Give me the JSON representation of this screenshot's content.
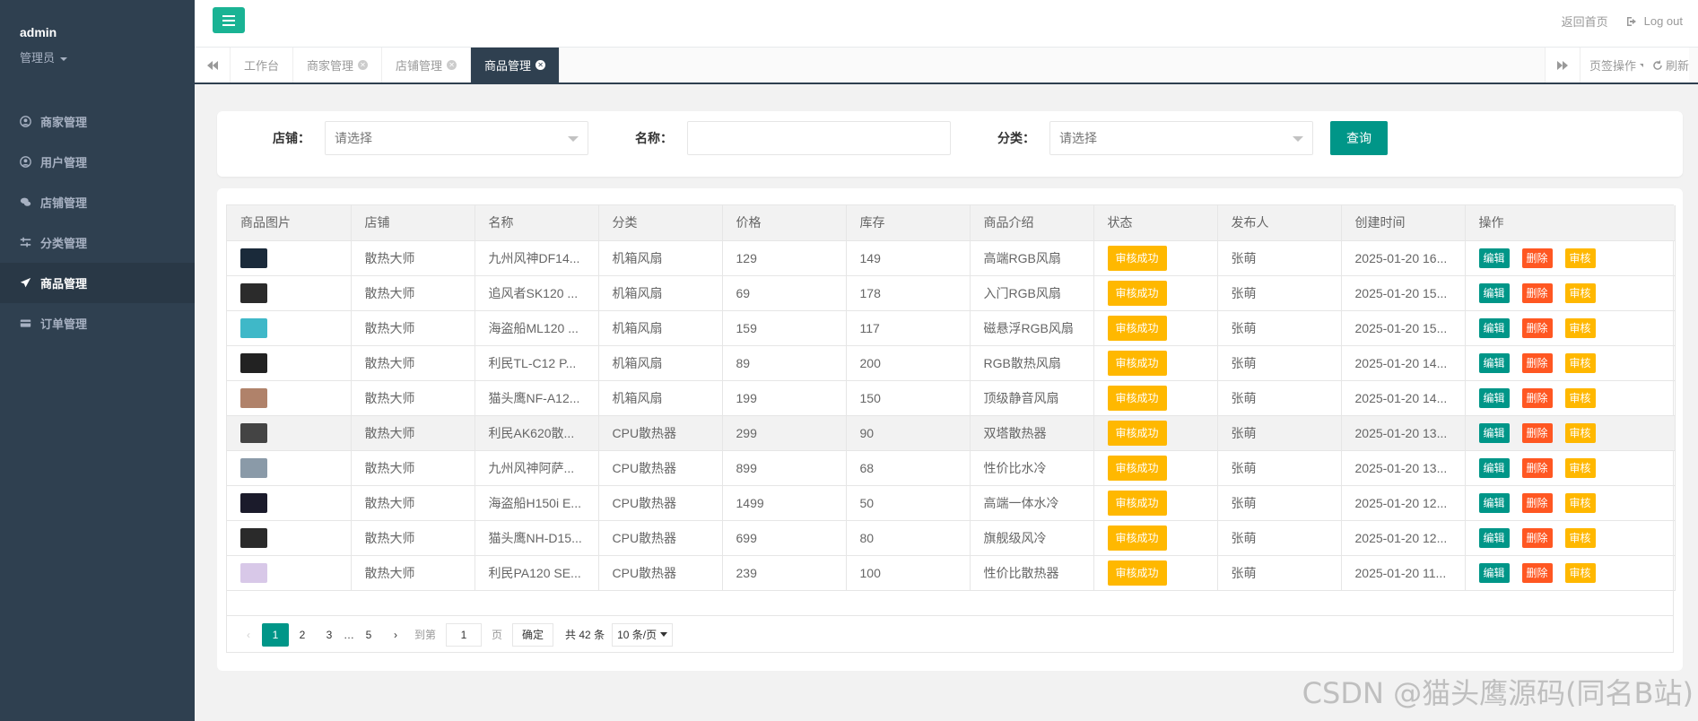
{
  "sidebar": {
    "user": "admin",
    "role": "管理员",
    "items": [
      {
        "label": "商家管理",
        "icon": "user-circle-icon",
        "active": false
      },
      {
        "label": "用户管理",
        "icon": "user-circle-icon",
        "active": false
      },
      {
        "label": "店铺管理",
        "icon": "comments-icon",
        "active": false
      },
      {
        "label": "分类管理",
        "icon": "sliders-icon",
        "active": false
      },
      {
        "label": "商品管理",
        "icon": "paper-plane-icon",
        "active": true
      },
      {
        "label": "订单管理",
        "icon": "credit-card-icon",
        "active": false
      }
    ]
  },
  "header": {
    "home_label": "返回首页",
    "logout_label": "Log out"
  },
  "tabs": {
    "items": [
      {
        "label": "工作台",
        "closable": false,
        "active": false
      },
      {
        "label": "商家管理",
        "closable": true,
        "active": false
      },
      {
        "label": "店铺管理",
        "closable": true,
        "active": false
      },
      {
        "label": "商品管理",
        "closable": true,
        "active": true
      }
    ],
    "ops_label": "页签操作",
    "refresh_label": "刷新"
  },
  "search": {
    "store_label": "店铺：",
    "store_placeholder": "请选择",
    "name_label": "名称：",
    "name_value": "",
    "category_label": "分类：",
    "category_placeholder": "请选择",
    "query_button": "查询"
  },
  "table": {
    "columns": [
      "商品图片",
      "店铺",
      "名称",
      "分类",
      "价格",
      "库存",
      "商品介绍",
      "状态",
      "发布人",
      "创建时间",
      "操作"
    ],
    "rows": [
      {
        "store": "散热大师",
        "name": "九州风神DF14...",
        "category": "机箱风扇",
        "price": "129",
        "stock": "149",
        "intro": "高端RGB风扇",
        "status": "审核成功",
        "publisher": "张萌",
        "created": "2025-01-20 16...",
        "thumb": "#1a2a3a"
      },
      {
        "store": "散热大师",
        "name": "追风者SK120 ...",
        "category": "机箱风扇",
        "price": "69",
        "stock": "178",
        "intro": "入门RGB风扇",
        "status": "审核成功",
        "publisher": "张萌",
        "created": "2025-01-20 15...",
        "thumb": "#2b2b2b"
      },
      {
        "store": "散热大师",
        "name": "海盗船ML120 ...",
        "category": "机箱风扇",
        "price": "159",
        "stock": "117",
        "intro": "磁悬浮RGB风扇",
        "status": "审核成功",
        "publisher": "张萌",
        "created": "2025-01-20 15...",
        "thumb": "#3fb8c8"
      },
      {
        "store": "散热大师",
        "name": "利民TL-C12 P...",
        "category": "机箱风扇",
        "price": "89",
        "stock": "200",
        "intro": "RGB散热风扇",
        "status": "审核成功",
        "publisher": "张萌",
        "created": "2025-01-20 14...",
        "thumb": "#222222"
      },
      {
        "store": "散热大师",
        "name": "猫头鹰NF-A12...",
        "category": "机箱风扇",
        "price": "199",
        "stock": "150",
        "intro": "顶级静音风扇",
        "status": "审核成功",
        "publisher": "张萌",
        "created": "2025-01-20 14...",
        "thumb": "#b0826a"
      },
      {
        "store": "散热大师",
        "name": "利民AK620散...",
        "category": "CPU散热器",
        "price": "299",
        "stock": "90",
        "intro": "双塔散热器",
        "status": "审核成功",
        "publisher": "张萌",
        "created": "2025-01-20 13...",
        "thumb": "#444444"
      },
      {
        "store": "散热大师",
        "name": "九州风神阿萨...",
        "category": "CPU散热器",
        "price": "899",
        "stock": "68",
        "intro": "性价比水冷",
        "status": "审核成功",
        "publisher": "张萌",
        "created": "2025-01-20 13...",
        "thumb": "#8a9aa8"
      },
      {
        "store": "散热大师",
        "name": "海盗船H150i E...",
        "category": "CPU散热器",
        "price": "1499",
        "stock": "50",
        "intro": "高端一体水冷",
        "status": "审核成功",
        "publisher": "张萌",
        "created": "2025-01-20 12...",
        "thumb": "#1b1b2b"
      },
      {
        "store": "散热大师",
        "name": "猫头鹰NH-D15...",
        "category": "CPU散热器",
        "price": "699",
        "stock": "80",
        "intro": "旗舰级风冷",
        "status": "审核成功",
        "publisher": "张萌",
        "created": "2025-01-20 12...",
        "thumb": "#2a2a2a"
      },
      {
        "store": "散热大师",
        "name": "利民PA120 SE...",
        "category": "CPU散热器",
        "price": "239",
        "stock": "100",
        "intro": "性价比散热器",
        "status": "审核成功",
        "publisher": "张萌",
        "created": "2025-01-20 11...",
        "thumb": "#d8c8e8"
      }
    ],
    "actions": {
      "edit": "编辑",
      "delete": "删除",
      "audit": "审核"
    }
  },
  "pager": {
    "pages": [
      "1",
      "2",
      "3",
      "…",
      "5"
    ],
    "current": "1",
    "goto_label": "到第",
    "goto_value": "1",
    "page_unit": "页",
    "confirm": "确定",
    "total": "共 42 条",
    "limit": "10 条/页"
  },
  "watermark": "CSDN @猫头鹰源码(同名B站)",
  "colors": {
    "sidebar_bg": "#2f4050",
    "accent": "#009688",
    "hamburger": "#1ab394",
    "status": "#ffb800",
    "danger": "#ff5722"
  }
}
